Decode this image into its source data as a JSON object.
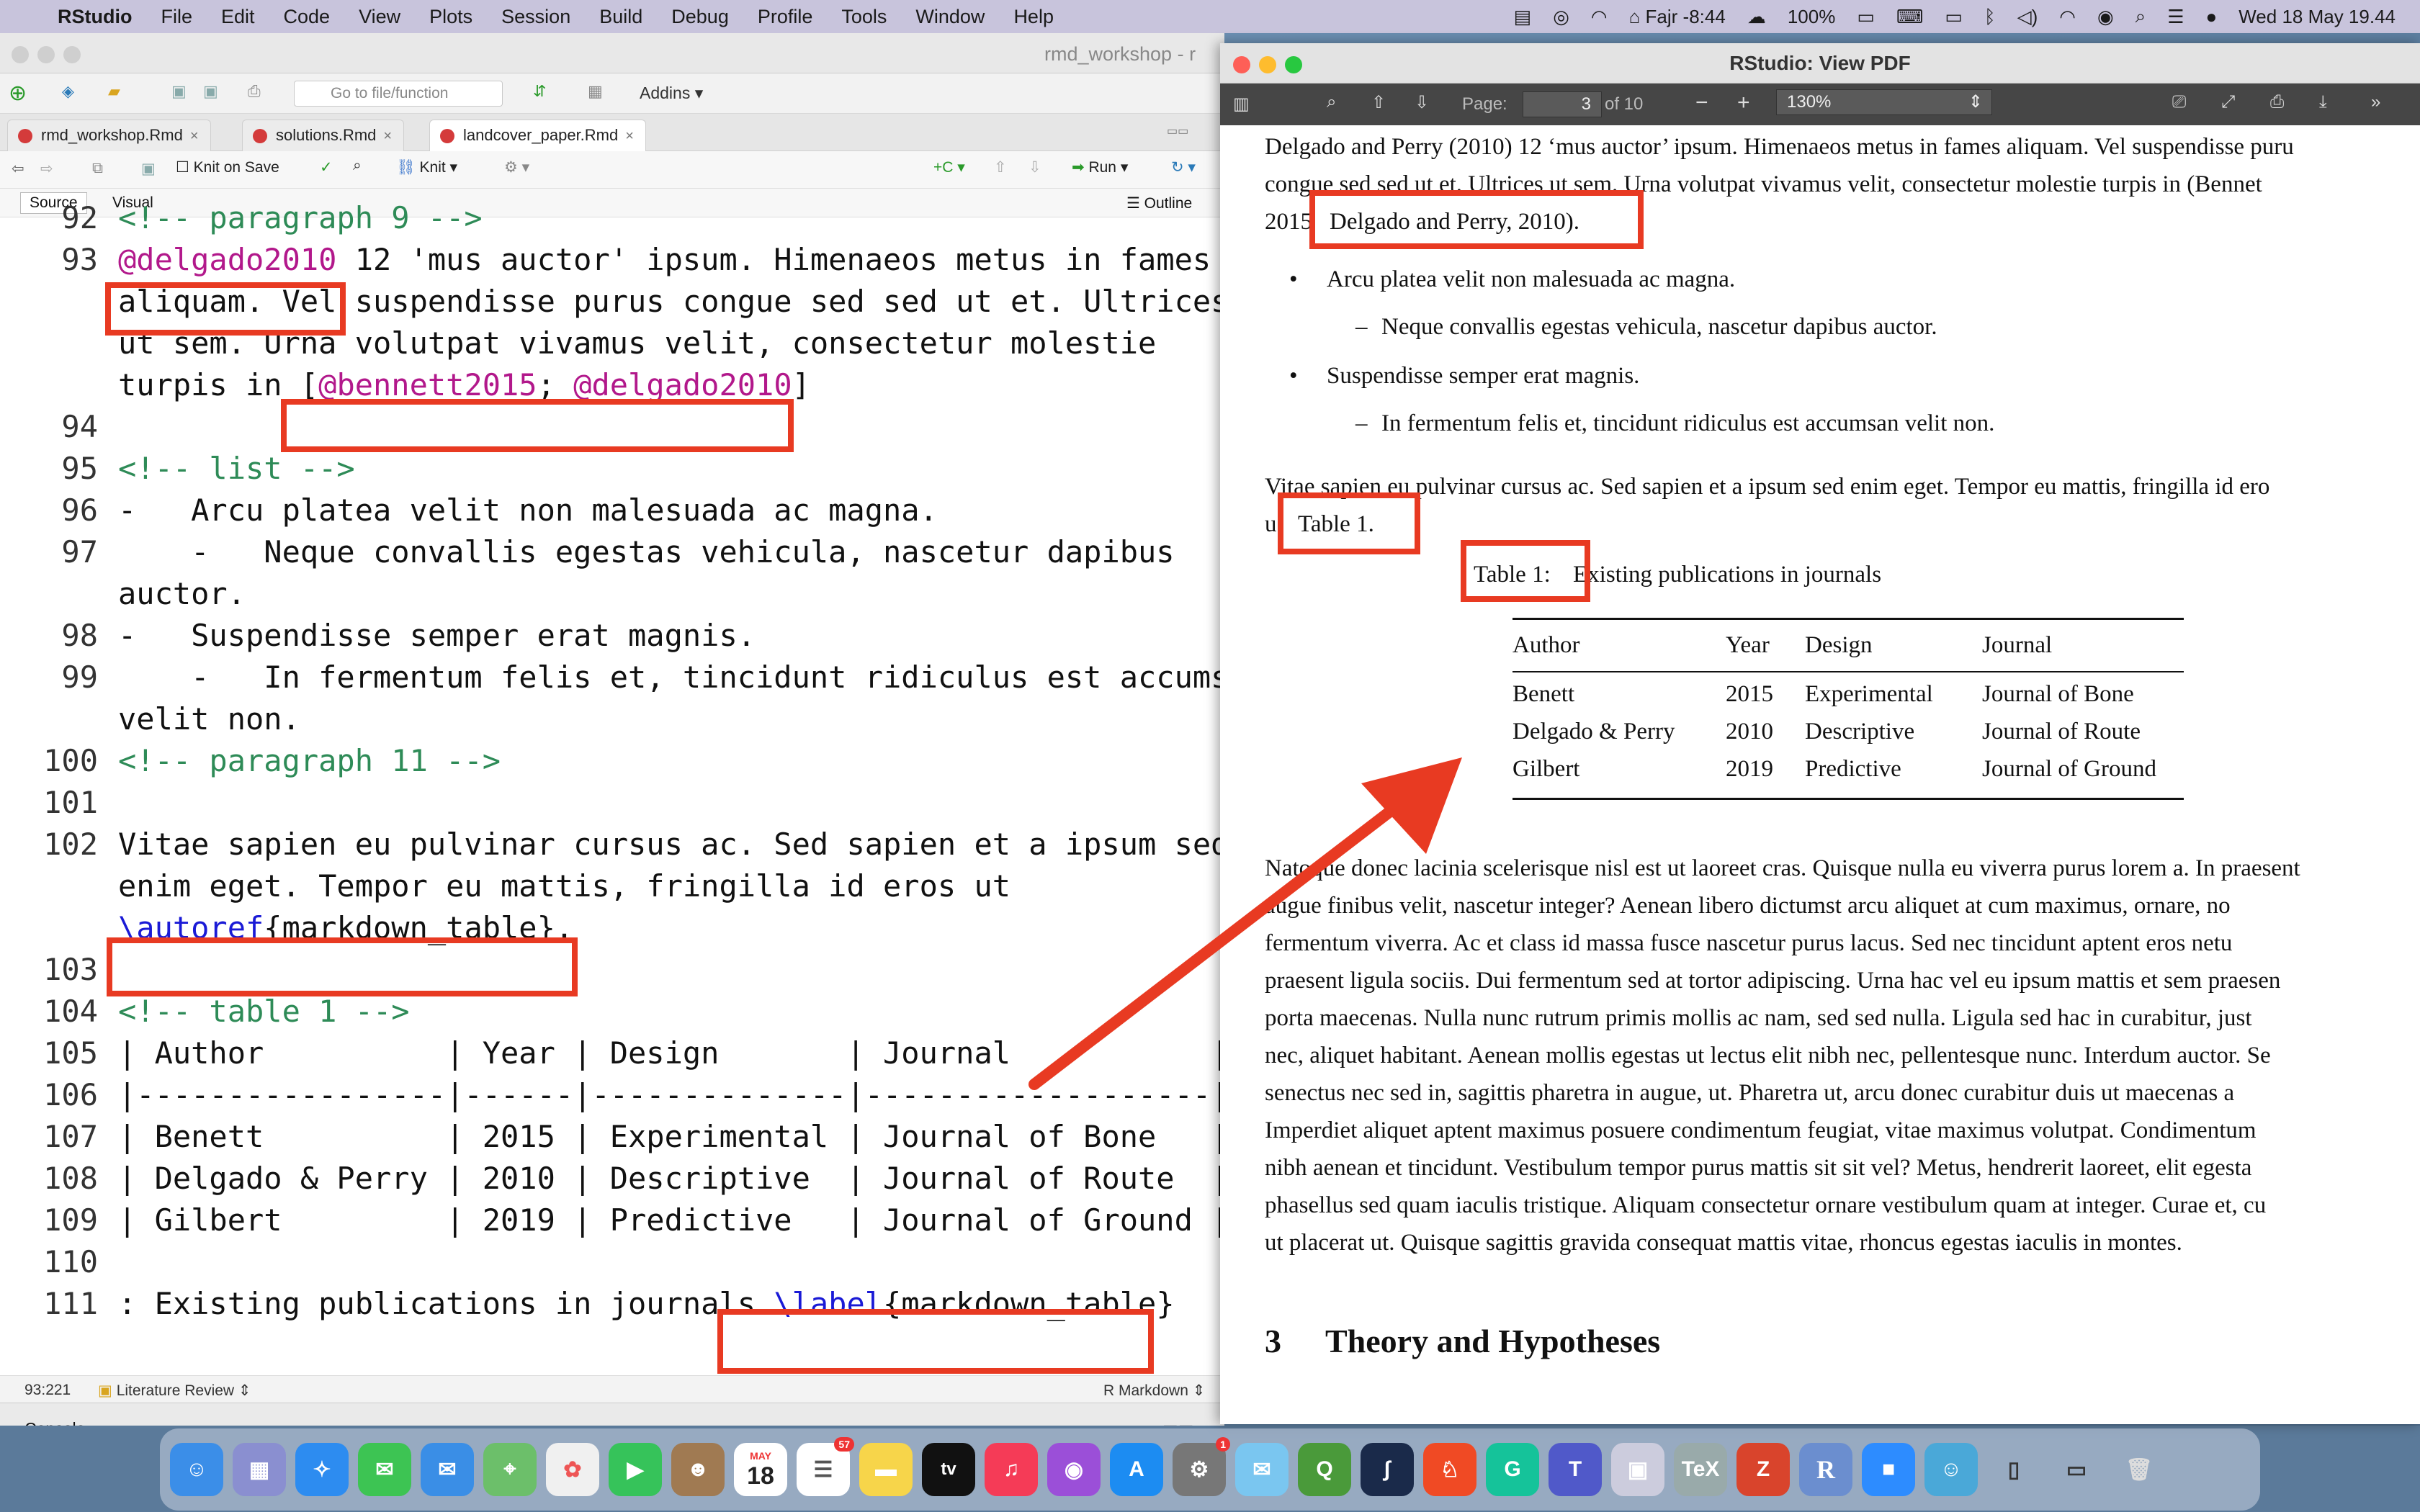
{
  "menubar": {
    "app": "RStudio",
    "items": [
      "File",
      "Edit",
      "Code",
      "View",
      "Plots",
      "Session",
      "Build",
      "Debug",
      "Profile",
      "Tools",
      "Window",
      "Help"
    ],
    "prayer": "Fajr -8:44",
    "battery": "100%",
    "datetime": "Wed 18 May  19.44"
  },
  "rstudio": {
    "window_title": "rmd_workshop - r",
    "goto_placeholder": "Go to file/function",
    "addins": "Addins",
    "tabs": [
      {
        "label": "rmd_workshop.Rmd"
      },
      {
        "label": "solutions.Rmd"
      },
      {
        "label": "landcover_paper.Rmd"
      }
    ],
    "knit_on_save": "Knit on Save",
    "knit": "Knit",
    "run": "Run",
    "source": "Source",
    "visual": "Visual",
    "outline": "Outline",
    "status_pos": "93:221",
    "status_section": "Literature Review",
    "status_mode": "R Markdown",
    "console": "Console"
  },
  "editor_lines": [
    {
      "n": "92",
      "t": "<!-- paragraph 9 -->"
    },
    {
      "n": "93",
      "t": "@delgado2010 12 'mus auctor' ipsum. Himenaeos metus in fames"
    },
    {
      "n": "",
      "t": "aliquam. Vel suspendisse purus congue sed sed ut et. Ultrices"
    },
    {
      "n": "",
      "t": "ut sem. Urna volutpat vivamus velit, consectetur molestie"
    },
    {
      "n": "",
      "t": "turpis in [@bennett2015; @delgado2010]"
    },
    {
      "n": "94",
      "t": ""
    },
    {
      "n": "95",
      "t": "<!-- list -->"
    },
    {
      "n": "96",
      "t": "-   Arcu platea velit non malesuada ac magna."
    },
    {
      "n": "97",
      "t": "    -   Neque convallis egestas vehicula, nascetur dapibus"
    },
    {
      "n": "",
      "t": "auctor."
    },
    {
      "n": "98",
      "t": "-   Suspendisse semper erat magnis."
    },
    {
      "n": "99",
      "t": "    -   In fermentum felis et, tincidunt ridiculus est accumsan"
    },
    {
      "n": "",
      "t": "velit non."
    },
    {
      "n": "100",
      "t": "<!-- paragraph 11 -->"
    },
    {
      "n": "101",
      "t": ""
    },
    {
      "n": "102",
      "t": "Vitae sapien eu pulvinar cursus ac. Sed sapien et a ipsum sed"
    },
    {
      "n": "",
      "t": "enim eget. Tempor eu mattis, fringilla id eros ut"
    },
    {
      "n": "",
      "t": "\\autoref{markdown_table}."
    },
    {
      "n": "103",
      "t": ""
    },
    {
      "n": "104",
      "t": "<!-- table 1 -->"
    },
    {
      "n": "105",
      "t": "| Author          | Year | Design       | Journal           |"
    },
    {
      "n": "106",
      "t": "|-----------------|------|--------------|-------------------|"
    },
    {
      "n": "107",
      "t": "| Benett          | 2015 | Experimental | Journal of Bone   |"
    },
    {
      "n": "108",
      "t": "| Delgado & Perry | 2010 | Descriptive  | Journal of Route  |"
    },
    {
      "n": "109",
      "t": "| Gilbert         | 2019 | Predictive   | Journal of Ground |"
    },
    {
      "n": "110",
      "t": ""
    },
    {
      "n": "111",
      "t": ": Existing publications in journals \\label{markdown_table}"
    }
  ],
  "pdf": {
    "window_title": "RStudio: View PDF",
    "page_label": "Page:",
    "page": "3",
    "page_of": "of 10",
    "zoom": "130%",
    "para1_line1": "Delgado and Perry (2010) 12 ‘mus auctor’ ipsum. Himenaeos metus in fames aliquam. Vel suspendisse puru",
    "para1_line2": "congue sed sed ut et. Ultrices ut sem. Urna volutpat vivamus velit, consectetur molestie turpis in (Bennet",
    "para1_line3a": "2015",
    "para1_line3b": "Delgado and Perry, 2010).",
    "bullet1": "Arcu platea velit non malesuada ac magna.",
    "sub1": "Neque convallis egestas vehicula, nascetur dapibus auctor.",
    "bullet2": "Suspendisse semper erat magnis.",
    "sub2": "In fermentum felis et, tincidunt ridiculus est accumsan velit non.",
    "para2_line1": "Vitae sapien eu pulvinar cursus ac. Sed sapien et a ipsum sed enim eget. Tempor eu mattis, fringilla id ero",
    "para2_line2a": "u",
    "para2_line2b": "Table 1.",
    "caption_a": "Table 1:",
    "caption_b": "Existing publications in journals",
    "table_headers": [
      "Author",
      "Year",
      "Design",
      "Journal"
    ],
    "table_rows": [
      [
        "Benett",
        "2015",
        "Experimental",
        "Journal of Bone"
      ],
      [
        "Delgado & Perry",
        "2010",
        "Descriptive",
        "Journal of Route"
      ],
      [
        "Gilbert",
        "2019",
        "Predictive",
        "Journal of Ground"
      ]
    ],
    "body_lines": [
      "Natoque donec lacinia scelerisque nisl est ut laoreet cras.  Quisque nulla eu viverra purus lorem a.  In praesent",
      "augue finibus velit, nascetur integer?  Aenean libero dictumst arcu aliquet at cum maximus, ornare, no",
      "fermentum viverra.  Ac et class id massa fusce nascetur purus lacus.  Sed nec tincidunt aptent eros netu",
      "praesent ligula sociis. Dui fermentum sed at tortor adipiscing. Urna hac vel eu ipsum mattis et sem praesen",
      "porta maecenas.  Nulla nunc rutrum primis mollis ac nam, sed sed nulla.  Ligula sed hac in curabitur, just",
      "nec, aliquet habitant.  Aenean mollis egestas ut lectus elit nibh nec, pellentesque nunc.  Interdum auctor.  Se",
      "senectus nec sed in, sagittis pharetra in augue, ut.  Pharetra ut, arcu donec curabitur duis ut maecenas a",
      "Imperdiet aliquet aptent maximus posuere condimentum feugiat, vitae maximus volutpat.  Condimentum",
      "nibh aenean et tincidunt. Vestibulum tempor purus mattis sit sit vel? Metus, hendrerit laoreet, elit egesta",
      "phasellus sed quam iaculis tristique.  Aliquam consectetur ornare vestibulum quam at integer.  Curae et, cu",
      "ut placerat ut.  Quisque sagittis gravida consequat mattis vitae, rhoncus egestas iaculis in montes."
    ],
    "section_num": "3",
    "section_title": "Theory and Hypotheses"
  },
  "dock": {
    "calendar_month": "MAY",
    "calendar_day": "18",
    "reminders_badge": "57",
    "settings_badge": "1",
    "tv_label": "tv",
    "r_label": "R"
  },
  "colors": {
    "highlight": "#e83a22",
    "citation": "#b2188b",
    "keyword": "#1a1ad6",
    "comment": "#2e8b57"
  }
}
